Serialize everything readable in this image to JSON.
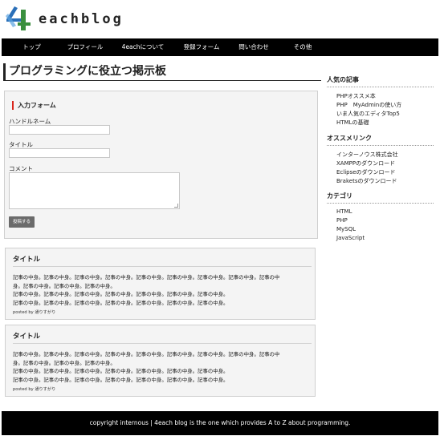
{
  "site": {
    "logo_text": "eachblog"
  },
  "nav": [
    {
      "label": "トップ"
    },
    {
      "label": "プロフィール"
    },
    {
      "label": "4eachについて"
    },
    {
      "label": "登録フォーム"
    },
    {
      "label": "問い合わせ"
    },
    {
      "label": "その他"
    }
  ],
  "page_title": "プログラミングに役立つ掲示板",
  "form": {
    "heading": "入力フォーム",
    "handle_label": "ハンドルネーム",
    "handle_value": "",
    "title_label": "タイトル",
    "title_value": "",
    "comment_label": "コメント",
    "comment_value": "",
    "submit_label": "投稿する"
  },
  "posts": [
    {
      "title": "タイトル",
      "lines": [
        "記事の中身。記事の中身。記事の中身。記事の中身。記事の中身。記事の中身。記事の中身。記事の中身。記事の中",
        "身。記事の中身。記事の中身。記事の中身。",
        "記事の中身。記事の中身。記事の中身。記事の中身。記事の中身。記事の中身。記事の中身。",
        "記事の中身。記事の中身。記事の中身。記事の中身。記事の中身。記事の中身。記事の中身。"
      ],
      "meta": "posted by 通りすがり"
    },
    {
      "title": "タイトル",
      "lines": [
        "記事の中身。記事の中身。記事の中身。記事の中身。記事の中身。記事の中身。記事の中身。記事の中身。記事の中",
        "身。記事の中身。記事の中身。記事の中身。",
        "記事の中身。記事の中身。記事の中身。記事の中身。記事の中身。記事の中身。記事の中身。",
        "記事の中身。記事の中身。記事の中身。記事の中身。記事の中身。記事の中身。記事の中身。"
      ],
      "meta": "posted by 通りすがり"
    }
  ],
  "sidebar": {
    "popular": {
      "heading": "人気の記事",
      "items": [
        "PHPオススメ本",
        "PHP　MyAdminの使い方",
        "いま人気のエディタTop5",
        "HTMLの基礎"
      ]
    },
    "recommend": {
      "heading": "オススメリンク",
      "items": [
        "インターノウス株式会社",
        "XAMPPのダウンロード",
        "Eclipseのダウンロード",
        "Braketsのダウンロード"
      ]
    },
    "category": {
      "heading": "カテゴリ",
      "items": [
        "HTML",
        "PHP",
        "MySQL",
        "JavaScript"
      ]
    }
  },
  "footer": {
    "text": "copyright internous | 4each blog is the one which provides A to Z about programming."
  },
  "colors": {
    "accent": "#d9261c",
    "logo_blue": "#2a6fb8",
    "logo_green": "#3a8f3e",
    "nav_bg": "#000000"
  }
}
